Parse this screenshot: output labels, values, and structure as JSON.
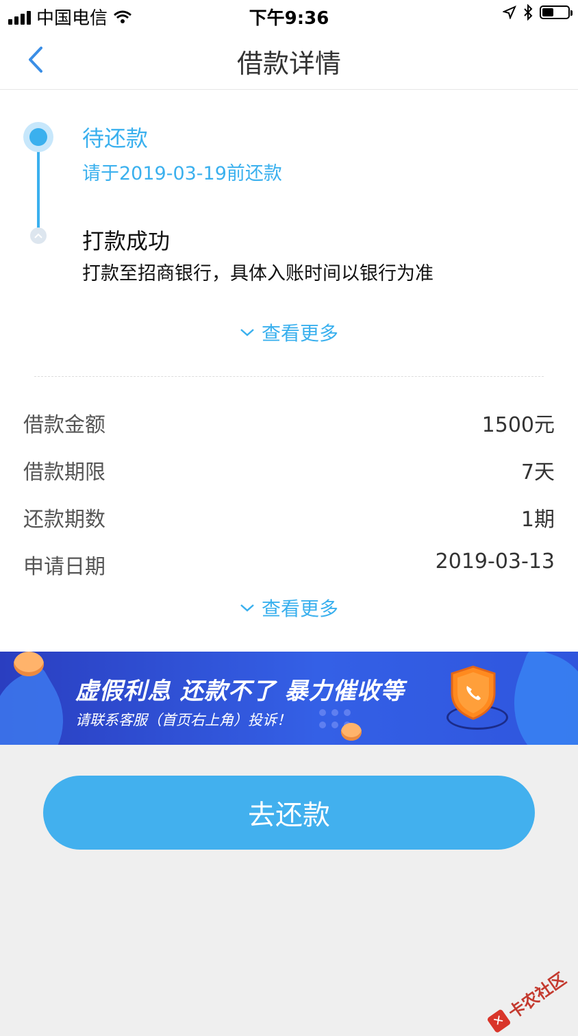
{
  "status_bar": {
    "carrier": "中国电信",
    "time": "下午9:36"
  },
  "nav": {
    "title": "借款详情",
    "back_icon": "chevron-left-icon"
  },
  "timeline": [
    {
      "title": "待还款",
      "subtitle": "请于2019-03-19前还款",
      "state": "active"
    },
    {
      "title": "打款成功",
      "subtitle": "打款至招商银行，具体入账时间以银行为准",
      "state": "done"
    }
  ],
  "more_label": "查看更多",
  "details": [
    {
      "label": "借款金额",
      "value": "1500元"
    },
    {
      "label": "借款期限",
      "value": "7天"
    },
    {
      "label": "还款期数",
      "value": "1期"
    },
    {
      "label": "申请日期",
      "value": "2019-03-13"
    }
  ],
  "banner": {
    "title": "虚假利息 还款不了 暴力催收等",
    "subtitle": "请联系客服（首页右上角）投诉！"
  },
  "cta": {
    "label": "去还款"
  },
  "watermark": "卡农社区",
  "colors": {
    "accent": "#3ab0ee",
    "button": "#42b0ee",
    "banner": "#3460e6",
    "shield": "#ff8a1f"
  }
}
